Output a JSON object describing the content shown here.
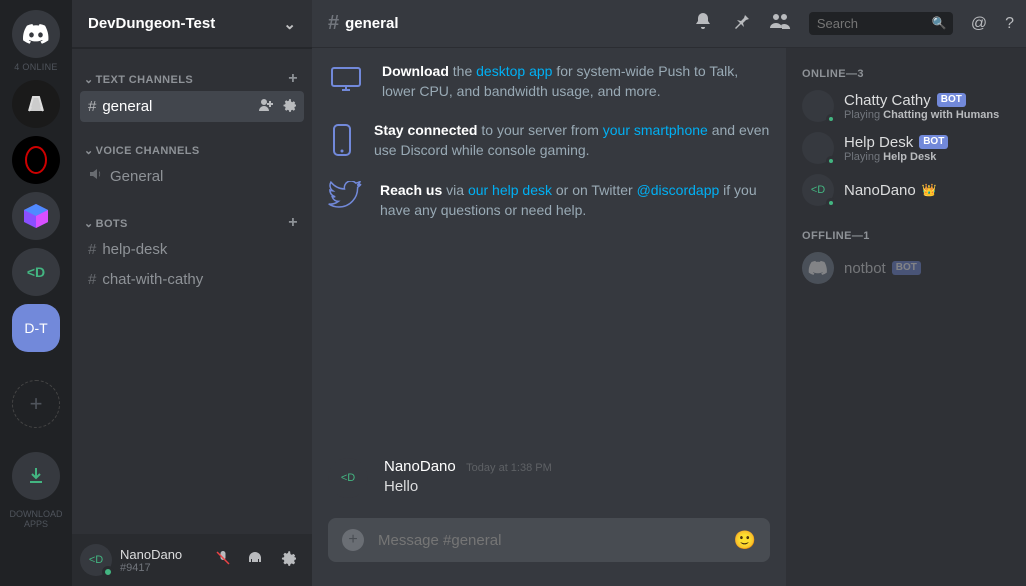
{
  "guilds": {
    "online_label": "4 ONLINE",
    "dt_label": "D-T",
    "download_label": "DOWNLOAD\nAPPS"
  },
  "server": {
    "name": "DevDungeon-Test"
  },
  "categories": {
    "text": {
      "label": "TEXT CHANNELS"
    },
    "voice": {
      "label": "VOICE CHANNELS"
    },
    "bots": {
      "label": "BOTS"
    }
  },
  "channels": {
    "general": "general",
    "voice_general": "General",
    "help_desk": "help-desk",
    "chat_cathy": "chat-with-cathy"
  },
  "user_panel": {
    "name": "NanoDano",
    "tag": "#9417"
  },
  "header": {
    "channel": "general",
    "search_placeholder": "Search"
  },
  "welcome": {
    "download": {
      "bold": "Download",
      "t1": " the ",
      "link": "desktop app",
      "t2": " for system-wide Push to Talk, lower CPU, and bandwidth usage, and more."
    },
    "stay": {
      "bold": "Stay connected",
      "t1": " to your server from ",
      "link": "your smartphone",
      "t2": " and even use Discord while console gaming."
    },
    "reach": {
      "bold": "Reach us",
      "t1": " via ",
      "link1": "our help desk",
      "t2": " or on Twitter ",
      "link2": "@discordapp",
      "t3": " if you have any questions or need help."
    }
  },
  "message": {
    "author": "NanoDano",
    "time": "Today at 1:38 PM",
    "body": "Hello"
  },
  "composer": {
    "placeholder": "Message #general"
  },
  "members": {
    "online_header": "ONLINE—3",
    "offline_header": "OFFLINE—1",
    "cathy": {
      "name": "Chatty Cathy",
      "sub_prefix": "Playing ",
      "sub_bold": "Chatting with Humans",
      "bot": "BOT"
    },
    "help": {
      "name": "Help Desk",
      "sub_prefix": "Playing ",
      "sub_bold": "Help Desk",
      "bot": "BOT"
    },
    "nano": {
      "name": "NanoDano"
    },
    "notbot": {
      "name": "notbot",
      "bot": "BOT"
    }
  }
}
